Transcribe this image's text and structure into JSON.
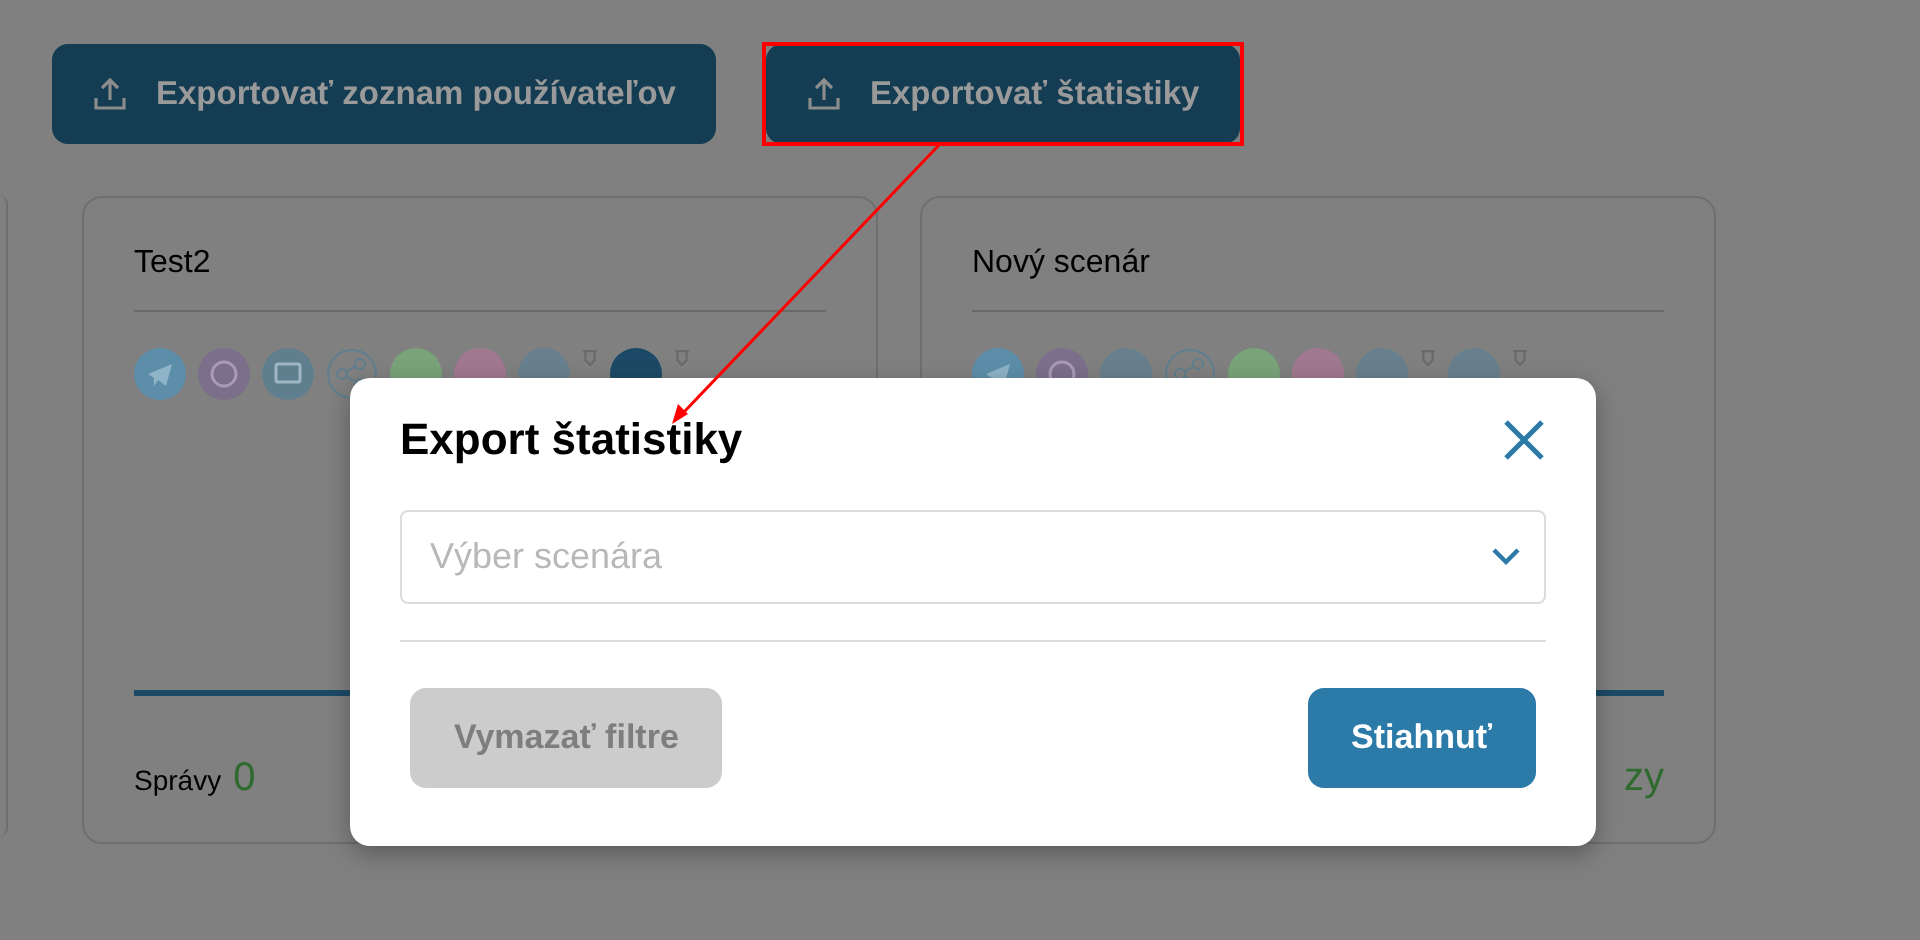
{
  "toolbar": {
    "buttons": [
      {
        "label": "Exportovať zoznam používateľov"
      },
      {
        "label": "Exportovať štatistiky"
      }
    ]
  },
  "cards": [
    {
      "title": "Test2",
      "footer": {
        "label": "Správy",
        "value": "0"
      }
    },
    {
      "title": "Nový scenár",
      "footer": {
        "value": "zy"
      }
    }
  ],
  "dialog": {
    "title": "Export štatistiky",
    "select": {
      "placeholder": "Výber scenára"
    },
    "buttons": [
      {
        "label": "Vymazať filtre",
        "disabled": true
      },
      {
        "label": "Stiahnuť",
        "disabled": false
      }
    ]
  }
}
